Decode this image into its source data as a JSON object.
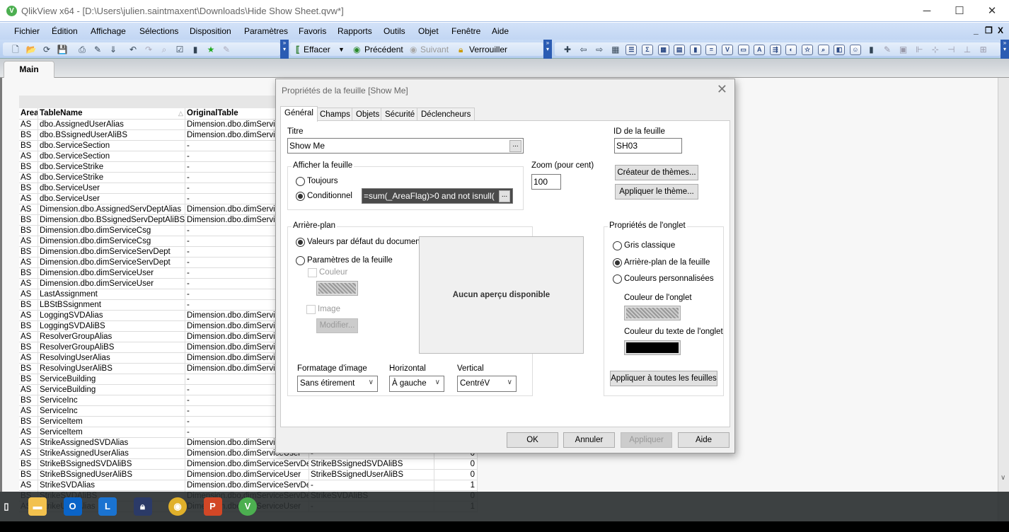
{
  "window": {
    "title": "QlikView x64 - [D:\\Users\\julien.saintmaxent\\Downloads\\Hide Show Sheet.qvw*]",
    "logo_letter": "V"
  },
  "menu": [
    "Fichier",
    "Édition",
    "Affichage",
    "Sélections",
    "Disposition",
    "Paramètres",
    "Favoris",
    "Rapports",
    "Outils",
    "Objet",
    "Fenêtre",
    "Aide"
  ],
  "toolbar": {
    "clear": "Effacer",
    "back": "Précédent",
    "forward": "Suivant",
    "lock": "Verrouiller",
    "icons_left": [
      "new-document",
      "open",
      "reload",
      "save",
      "print",
      "edit-script",
      "reload-data",
      "undo",
      "redo",
      "search",
      "current-selections",
      "chart-wizard",
      "bookmark",
      "edit-expression"
    ],
    "icons_right": [
      "new-sheet",
      "promote-sheet",
      "demote-sheet",
      "sheet-properties",
      "list-box",
      "statistics-box",
      "table-box",
      "multi-box",
      "chart",
      "input-box",
      "current-selections-box",
      "button",
      "text-object",
      "line-arrow",
      "slider",
      "bookmark-object",
      "search-object",
      "container",
      "custom-object",
      "chart-wizard",
      "format-painter",
      "design-grid",
      "align-left",
      "center-horizontal",
      "align-right",
      "align-bottom",
      "space-horizontal"
    ]
  },
  "tabs": [
    {
      "label": "Main",
      "active": true
    }
  ],
  "table": {
    "headers": [
      "Area",
      "TableName",
      "OriginalTable",
      "",
      ""
    ],
    "rows": [
      [
        "AS",
        "dbo.AssignedUserAlias",
        "Dimension.dbo.dimService",
        "",
        ""
      ],
      [
        "BS",
        "dbo.BSsignedUserAliBS",
        "Dimension.dbo.dimService",
        "",
        ""
      ],
      [
        "BS",
        "dbo.ServiceSection",
        "-",
        "",
        ""
      ],
      [
        "AS",
        "dbo.ServiceSection",
        "-",
        "",
        ""
      ],
      [
        "BS",
        "dbo.ServiceStrike",
        "-",
        "",
        ""
      ],
      [
        "AS",
        "dbo.ServiceStrike",
        "-",
        "",
        ""
      ],
      [
        "BS",
        "dbo.ServiceUser",
        "-",
        "",
        ""
      ],
      [
        "AS",
        "dbo.ServiceUser",
        "-",
        "",
        ""
      ],
      [
        "AS",
        "Dimension.dbo.AssignedServDeptAlias",
        "Dimension.dbo.dimService",
        "",
        ""
      ],
      [
        "BS",
        "Dimension.dbo.BSsignedServDeptAliBS",
        "Dimension.dbo.dimService",
        "",
        ""
      ],
      [
        "BS",
        "Dimension.dbo.dimServiceCsg",
        "-",
        "",
        ""
      ],
      [
        "AS",
        "Dimension.dbo.dimServiceCsg",
        "-",
        "",
        ""
      ],
      [
        "BS",
        "Dimension.dbo.dimServiceServDept",
        "-",
        "",
        ""
      ],
      [
        "AS",
        "Dimension.dbo.dimServiceServDept",
        "-",
        "",
        ""
      ],
      [
        "BS",
        "Dimension.dbo.dimServiceUser",
        "-",
        "",
        ""
      ],
      [
        "AS",
        "Dimension.dbo.dimServiceUser",
        "-",
        "",
        ""
      ],
      [
        "AS",
        "LastAssignment",
        "-",
        "",
        ""
      ],
      [
        "BS",
        "LBStBSsignment",
        "-",
        "",
        ""
      ],
      [
        "AS",
        "LoggingSVDAlias",
        "Dimension.dbo.dimService",
        "",
        ""
      ],
      [
        "BS",
        "LoggingSVDAliBS",
        "Dimension.dbo.dimService",
        "",
        ""
      ],
      [
        "AS",
        "ResolverGroupAlias",
        "Dimension.dbo.dimService",
        "",
        ""
      ],
      [
        "BS",
        "ResolverGroupAliBS",
        "Dimension.dbo.dimService",
        "",
        ""
      ],
      [
        "AS",
        "ResolvingUserAlias",
        "Dimension.dbo.dimService",
        "",
        ""
      ],
      [
        "BS",
        "ResolvingUserAliBS",
        "Dimension.dbo.dimService",
        "",
        ""
      ],
      [
        "BS",
        "ServiceBuilding",
        "-",
        "",
        ""
      ],
      [
        "AS",
        "ServiceBuilding",
        "-",
        "",
        ""
      ],
      [
        "BS",
        "ServiceInc",
        "-",
        "",
        ""
      ],
      [
        "AS",
        "ServiceInc",
        "-",
        "",
        ""
      ],
      [
        "BS",
        "ServiceItem",
        "-",
        "",
        ""
      ],
      [
        "AS",
        "ServiceItem",
        "-",
        "",
        ""
      ],
      [
        "AS",
        "StrikeAssignedSVDAlias",
        "Dimension.dbo.dimService",
        "",
        ""
      ],
      [
        "AS",
        "StrikeAssignedUserAlias",
        "Dimension.dbo.dimServiceUser",
        "-",
        "0"
      ],
      [
        "BS",
        "StrikeBSsignedSVDAliBS",
        "Dimension.dbo.dimServiceServDept",
        "StrikeBSsignedSVDAliBS",
        "0"
      ],
      [
        "BS",
        "StrikeBSsignedUserAliBS",
        "Dimension.dbo.dimServiceUser",
        "StrikeBSsignedUserAliBS",
        "0"
      ],
      [
        "AS",
        "StrikeSVDAlias",
        "Dimension.dbo.dimServiceServDept",
        "-",
        "1"
      ],
      [
        "BS",
        "StrikeSVDAliBS",
        "Dimension.dbo.dimServiceServDept",
        "StrikeSVDAliBS",
        "0"
      ],
      [
        "AS",
        "StrikeUserAlias",
        "Dimension.dbo.dimServiceUser",
        "-",
        "1"
      ]
    ]
  },
  "dialog": {
    "title": "Propriétés de la feuille [Show Me]",
    "tabs": [
      "Général",
      "Champs",
      "Objets",
      "Sécurité",
      "Déclencheurs"
    ],
    "title_label": "Titre",
    "title_value": "Show Me",
    "ellipsis": "...",
    "sheet_id_label": "ID de la feuille",
    "sheet_id": "SH03",
    "show_group": "Afficher la feuille",
    "always": "Toujours",
    "conditional": "Conditionnel",
    "condition": "=sum(_AreaFlag)>0 and not isnull(",
    "zoom_label": "Zoom (pour cent)",
    "zoom": "100",
    "theme_maker": "Créateur de thèmes...",
    "apply_theme": "Appliquer le thème...",
    "background_group": "Arrière-plan",
    "doc_defaults": "Valeurs par défaut du document",
    "sheet_settings": "Paramètres de la feuille",
    "color": "Couleur",
    "image": "Image",
    "modify": "Modifier...",
    "no_preview": "Aucun aperçu disponible",
    "image_format_label": "Formatage d'image",
    "image_format": "Sans étirement",
    "horizontal_label": "Horizontal",
    "horizontal": "À gauche",
    "vertical_label": "Vertical",
    "vertical": "CentréV",
    "tab_props_group": "Propriétés de l'onglet",
    "classic_gray": "Gris classique",
    "sheet_background": "Arrière-plan de la feuille",
    "custom_colors": "Couleurs personnalisées",
    "tab_color_label": "Couleur de l'onglet",
    "tab_text_color_label": "Couleur du texte de l'onglet",
    "tab_text_color": "#000000",
    "apply_all": "Appliquer à toutes les feuilles",
    "ok": "OK",
    "cancel": "Annuler",
    "apply": "Appliquer",
    "help": "Aide"
  },
  "taskbar": [
    "task-view",
    "file-explorer",
    "outlook",
    "lync",
    "keepass",
    "chrome",
    "powerpoint",
    "qlikview"
  ]
}
